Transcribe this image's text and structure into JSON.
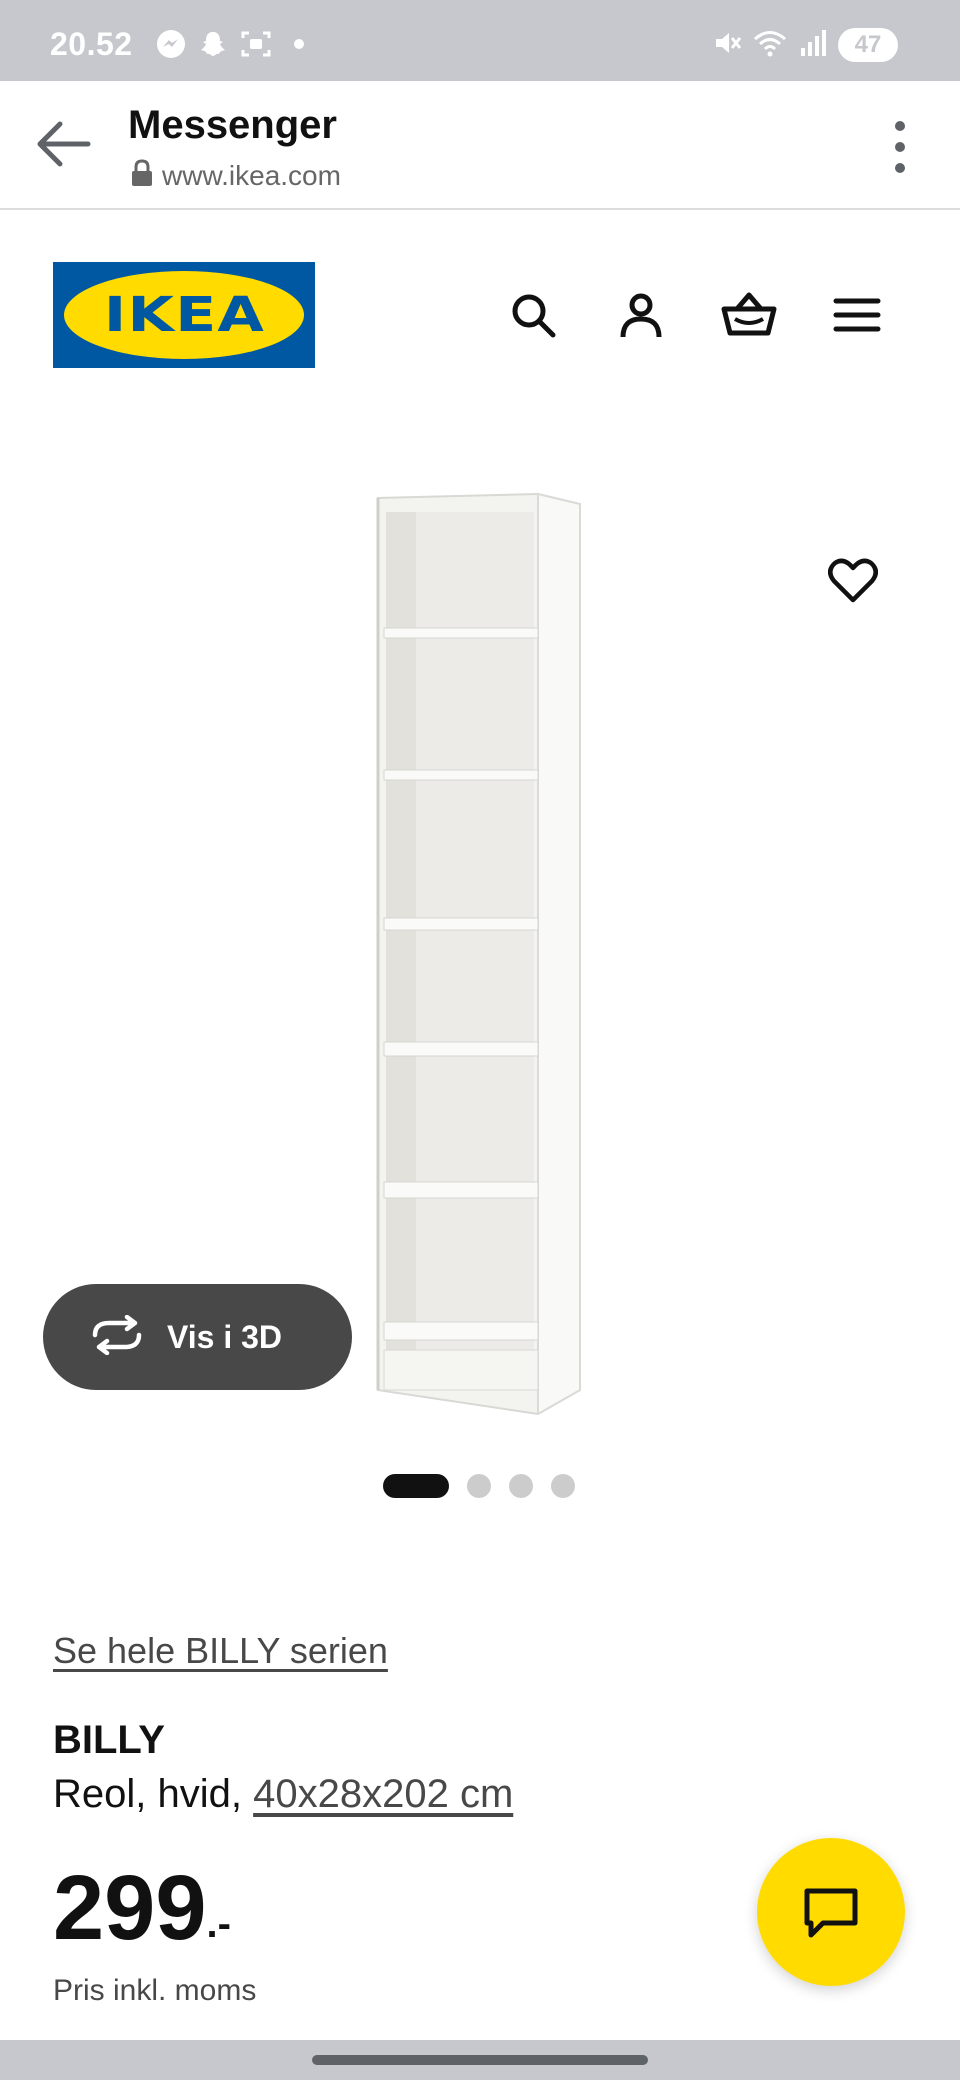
{
  "status_bar": {
    "time": "20.52",
    "left_icons": [
      "messenger-icon",
      "snapchat-icon",
      "screenshot-icon",
      "dot-icon"
    ],
    "right_icons": [
      "mute-icon",
      "wifi-icon",
      "signal-icon"
    ],
    "battery": "47"
  },
  "browser": {
    "title": "Messenger",
    "url": "www.ikea.com"
  },
  "header": {
    "logo_text": "IKEA",
    "icons": [
      "search-icon",
      "account-icon",
      "basket-icon",
      "menu-icon"
    ]
  },
  "gallery": {
    "view_3d_label": "Vis i 3D",
    "total_images": 4,
    "active_index": 0
  },
  "product": {
    "series_link": "Se hele BILLY serien",
    "name": "BILLY",
    "description_prefix": "Reol, hvid, ",
    "dimensions": "40x28x202 cm",
    "price": "299",
    "price_suffix": ".-",
    "price_note": "Pris inkl. moms"
  },
  "colors": {
    "ikea_blue": "#0058a3",
    "ikea_yellow": "#ffdb00",
    "system_bar": "#c6c8cd"
  }
}
